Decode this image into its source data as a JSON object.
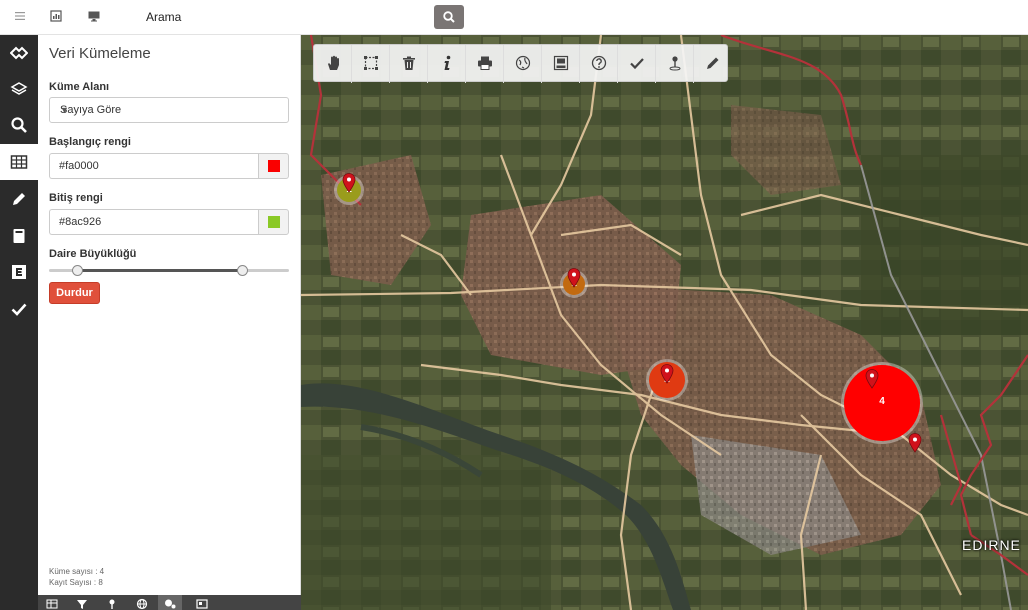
{
  "topbar": {
    "title": "Arama",
    "icons": [
      "menu-icon",
      "chart-icon",
      "monitor-icon",
      "search-icon"
    ]
  },
  "rail": {
    "items": [
      "logo-icon",
      "layers-icon",
      "search-icon",
      "table-icon",
      "pencil-icon",
      "book-icon",
      "e-icon",
      "check-icon"
    ],
    "active": "table-icon"
  },
  "panel": {
    "title": "Veri Kümeleme",
    "cluster_field_label": "Küme Alanı",
    "cluster_field_value": "Sayıya Göre",
    "start_color_label": "Başlangıç rengi",
    "start_color_value": "#fa0000",
    "end_color_label": "Bitiş rengi",
    "end_color_value": "#8ac926",
    "circle_size_label": "Daire Büyüklüğü",
    "circle_size_range": [
      0.1,
      0.82
    ],
    "stop_label": "Durdur",
    "cluster_count": "Küme sayısı : 4",
    "record_count": "Kayıt Sayısı : 8"
  },
  "colors": {
    "start": "#fa0000",
    "end": "#8ac926",
    "button": "#e0503b"
  },
  "map": {
    "toolbar_icons": [
      "hand-icon",
      "select-box-icon",
      "trash-icon",
      "info-icon",
      "print-icon",
      "globe-icon",
      "export-image-icon",
      "help-icon",
      "check-icon",
      "pin-icon",
      "pencil-icon"
    ],
    "clusters": [
      {
        "label": "4",
        "color": "#ff0000"
      },
      {
        "label": "2",
        "color": "#e03a12"
      },
      {
        "label": "1",
        "color": "#c26a10"
      },
      {
        "label": "1",
        "color": "#9a9c1c"
      }
    ],
    "city_label": "EDIRNE"
  }
}
